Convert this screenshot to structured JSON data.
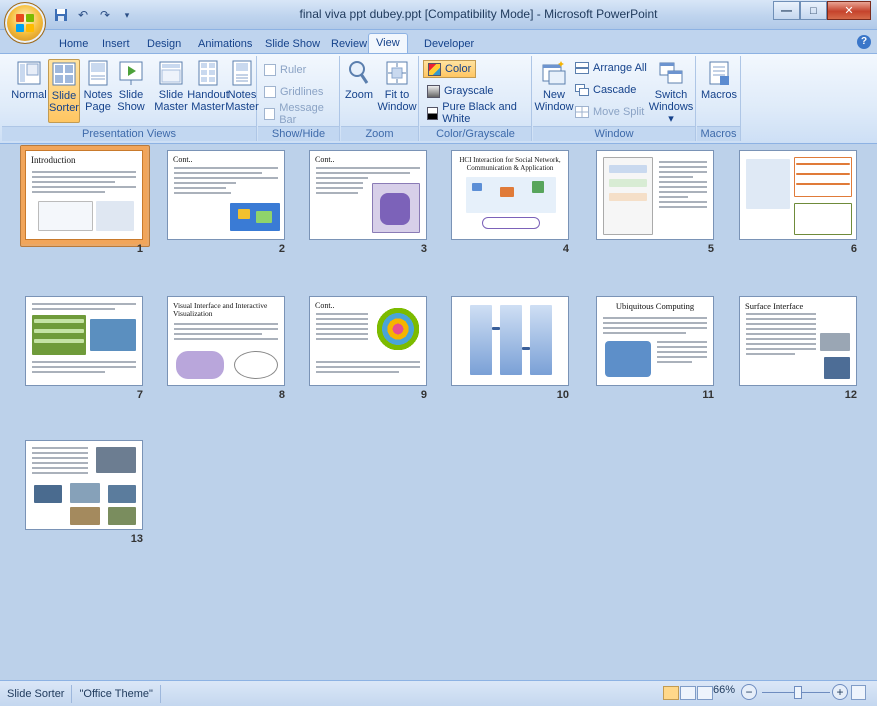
{
  "window": {
    "title": "final viva ppt dubey.ppt [Compatibility Mode] - Microsoft PowerPoint"
  },
  "qat": {
    "save_icon": "save-icon",
    "undo_icon": "undo-icon",
    "redo_icon": "redo-icon",
    "more_icon": "chevron-down-icon"
  },
  "tabs": [
    "Home",
    "Insert",
    "Design",
    "Animations",
    "Slide Show",
    "Review",
    "View",
    "Developer"
  ],
  "active_tab": "View",
  "ribbon": {
    "presentation_views": {
      "label": "Presentation Views",
      "normal": "Normal",
      "slide_sorter_1": "Slide",
      "slide_sorter_2": "Sorter",
      "notes_page_1": "Notes",
      "notes_page_2": "Page",
      "slide_show_1": "Slide",
      "slide_show_2": "Show",
      "slide_master_1": "Slide",
      "slide_master_2": "Master",
      "handout_master_1": "Handout",
      "handout_master_2": "Master",
      "notes_master_1": "Notes",
      "notes_master_2": "Master"
    },
    "show_hide": {
      "label": "Show/Hide",
      "ruler": "Ruler",
      "gridlines": "Gridlines",
      "message_bar": "Message Bar"
    },
    "zoom": {
      "label": "Zoom",
      "zoom": "Zoom",
      "fit_1": "Fit to",
      "fit_2": "Window"
    },
    "color": {
      "label": "Color/Grayscale",
      "color": "Color",
      "grayscale": "Grayscale",
      "pure": "Pure Black and White"
    },
    "window": {
      "label": "Window",
      "new_1": "New",
      "new_2": "Window",
      "arrange_all": "Arrange All",
      "cascade": "Cascade",
      "move_split": "Move Split",
      "switch_1": "Switch",
      "switch_2": "Windows"
    },
    "macros": {
      "label": "Macros",
      "macros": "Macros"
    }
  },
  "slides": [
    {
      "num": "1",
      "title": "Introduction"
    },
    {
      "num": "2",
      "title": "Cont.."
    },
    {
      "num": "3",
      "title": "Cont.."
    },
    {
      "num": "4",
      "title": "HCI Interaction for Social Network, Communication & Application"
    },
    {
      "num": "5",
      "title": ""
    },
    {
      "num": "6",
      "title": ""
    },
    {
      "num": "7",
      "title": ""
    },
    {
      "num": "8",
      "title": "Visual Interface and Interactive Visualization"
    },
    {
      "num": "9",
      "title": "Cont.."
    },
    {
      "num": "10",
      "title": ""
    },
    {
      "num": "11",
      "title": "Ubiquitous Computing"
    },
    {
      "num": "12",
      "title": "Surface Interface"
    },
    {
      "num": "13",
      "title": ""
    }
  ],
  "selected_slide": 1,
  "status": {
    "view": "Slide Sorter",
    "theme": "\"Office Theme\"",
    "zoom": "66%"
  },
  "colors": {
    "selection": "#f1a55a",
    "workspace": "#bcd1ea",
    "ribbon_accent": "#ffc663"
  }
}
